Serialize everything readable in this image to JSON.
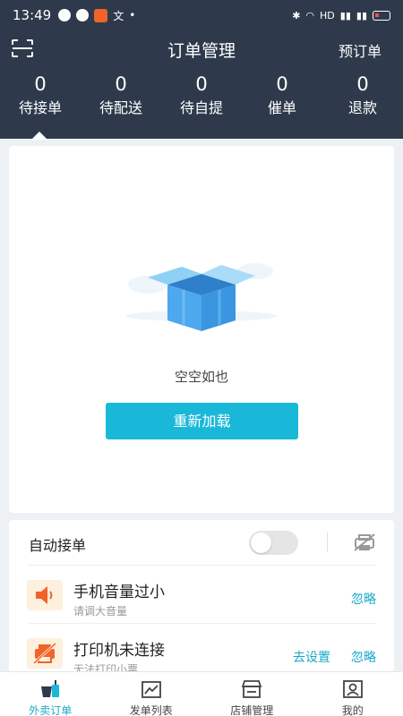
{
  "status_bar": {
    "time": "13:49",
    "network": "HD"
  },
  "header": {
    "title": "订单管理",
    "preorder": "预订单"
  },
  "stats": [
    {
      "count": "0",
      "label": "待接单"
    },
    {
      "count": "0",
      "label": "待配送"
    },
    {
      "count": "0",
      "label": "待自提"
    },
    {
      "count": "0",
      "label": "催单"
    },
    {
      "count": "0",
      "label": "退款"
    }
  ],
  "empty": {
    "text": "空空如也",
    "reload_label": "重新加载"
  },
  "settings": {
    "auto_accept_label": "自动接单",
    "auto_accept_on": false,
    "volume": {
      "title": "手机音量过小",
      "subtitle": "请调大音量",
      "ignore": "忽略"
    },
    "printer": {
      "title": "打印机未连接",
      "subtitle": "无法打印小票",
      "setup": "去设置",
      "ignore": "忽略"
    }
  },
  "nav": [
    {
      "label": "外卖订单",
      "icon": "takeout-cup-icon",
      "active": true
    },
    {
      "label": "发单列表",
      "icon": "dispatch-list-icon",
      "active": false
    },
    {
      "label": "店铺管理",
      "icon": "store-icon",
      "active": false
    },
    {
      "label": "我的",
      "icon": "profile-icon",
      "active": false
    }
  ],
  "colors": {
    "header_bg": "#2e3a4b",
    "accent": "#19b8d9",
    "warn_bg": "#fdf0dc",
    "warn_icon": "#f0642a"
  }
}
